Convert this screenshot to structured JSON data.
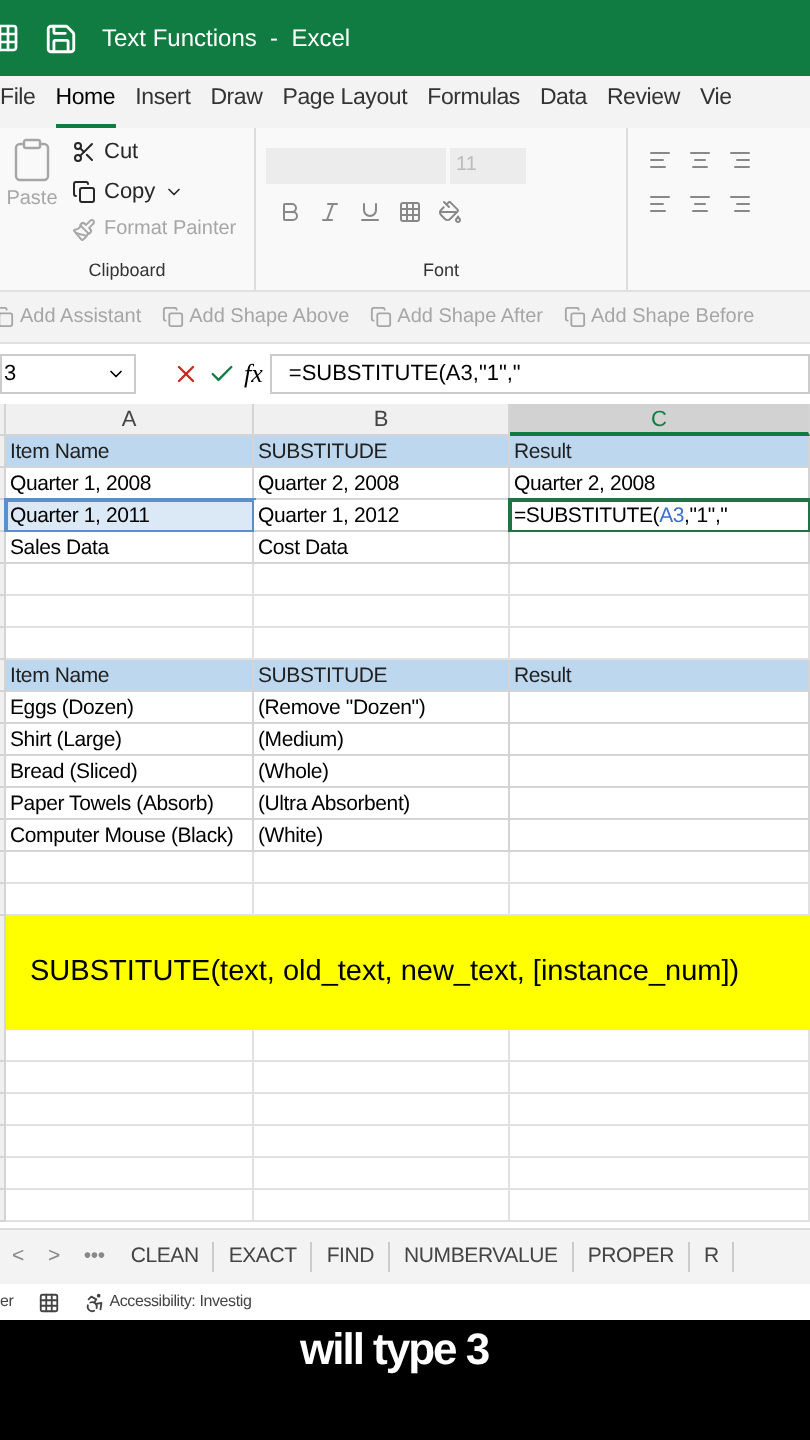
{
  "window": {
    "title": "Text Functions  -  Excel"
  },
  "menu_tabs": [
    {
      "label": "File",
      "selected": false
    },
    {
      "label": "Home",
      "selected": true
    },
    {
      "label": "Insert",
      "selected": false
    },
    {
      "label": "Draw",
      "selected": false
    },
    {
      "label": "Page Layout",
      "selected": false
    },
    {
      "label": "Formulas",
      "selected": false
    },
    {
      "label": "Data",
      "selected": false
    },
    {
      "label": "Review",
      "selected": false
    },
    {
      "label": "Vie",
      "selected": false
    }
  ],
  "clipboard": {
    "paste": {
      "label": "Paste",
      "disabled": true
    },
    "cut": {
      "label": "Cut",
      "disabled": false
    },
    "copy": {
      "label": "Copy",
      "disabled": false
    },
    "format_painter": {
      "label": "Format Painter",
      "disabled": true
    },
    "group_label": "Clipboard"
  },
  "font": {
    "size": "11",
    "group_label": "Font"
  },
  "smartart_bar": [
    {
      "label": "Add Assistant",
      "disabled": true
    },
    {
      "label": "Add Shape Above",
      "disabled": true
    },
    {
      "label": "Add Shape After",
      "disabled": true
    },
    {
      "label": "Add Shape Before",
      "disabled": true
    }
  ],
  "formula_bar": {
    "name_box": "3",
    "function_label": "fx",
    "formula": "=SUBSTITUTE(A3,\"1\",\""
  },
  "columns": [
    {
      "label": "A",
      "selected": false
    },
    {
      "label": "B",
      "selected": false
    },
    {
      "label": "C",
      "selected": true
    }
  ],
  "rows": [
    {
      "kind": "header",
      "cells": [
        "Item Name",
        "SUBSTITUDE",
        "Result"
      ]
    },
    {
      "kind": "data",
      "cells": [
        "Quarter 1, 2008",
        "Quarter 2, 2008",
        "Quarter 2, 2008"
      ]
    },
    {
      "kind": "data",
      "cells": [
        {
          "text": "Quarter 1, 2011",
          "selected": true
        },
        "Quarter 1, 2012",
        {
          "editing": true,
          "parts": [
            {
              "text": "=SUBSTITUTE(",
              "ref": false
            },
            {
              "text": "A3",
              "ref": true
            },
            {
              "text": ",\"1\",\"",
              "ref": false
            }
          ]
        }
      ]
    },
    {
      "kind": "data",
      "cells": [
        "Sales Data",
        "Cost Data",
        ""
      ]
    },
    {
      "kind": "empty"
    },
    {
      "kind": "empty"
    },
    {
      "kind": "empty"
    },
    {
      "kind": "header",
      "cells": [
        "Item Name",
        "SUBSTITUDE",
        "Result"
      ]
    },
    {
      "kind": "data",
      "cells": [
        "Eggs (Dozen)",
        "(Remove \"Dozen\")",
        ""
      ]
    },
    {
      "kind": "data",
      "cells": [
        "Shirt (Large)",
        "(Medium)",
        ""
      ]
    },
    {
      "kind": "data",
      "cells": [
        "Bread (Sliced)",
        "(Whole)",
        ""
      ]
    },
    {
      "kind": "data",
      "cells": [
        "Paper Towels (Absorb)",
        "(Ultra Absorbent)",
        ""
      ]
    },
    {
      "kind": "data",
      "cells": [
        "Computer Mouse (Black)",
        "(White)",
        ""
      ]
    },
    {
      "kind": "empty"
    },
    {
      "kind": "empty"
    },
    {
      "kind": "banner",
      "text": "SUBSTITUTE(text, old_text, new_text, [instance_num])"
    },
    {
      "kind": "empty"
    },
    {
      "kind": "empty"
    },
    {
      "kind": "empty"
    },
    {
      "kind": "empty"
    },
    {
      "kind": "empty"
    },
    {
      "kind": "empty"
    }
  ],
  "sheet_nav": [
    "<",
    ">",
    "•••"
  ],
  "sheet_tabs": [
    {
      "label": "CLEAN",
      "selected": false
    },
    {
      "label": "EXACT",
      "selected": false
    },
    {
      "label": "FIND",
      "selected": false
    },
    {
      "label": "NUMBERVALUE",
      "selected": false
    },
    {
      "label": "PROPER",
      "selected": false
    },
    {
      "label": "R",
      "selected": false
    }
  ],
  "status_bar": {
    "left": "er",
    "accessibility": "Accessibility: Investig"
  },
  "caption": "will type 3"
}
